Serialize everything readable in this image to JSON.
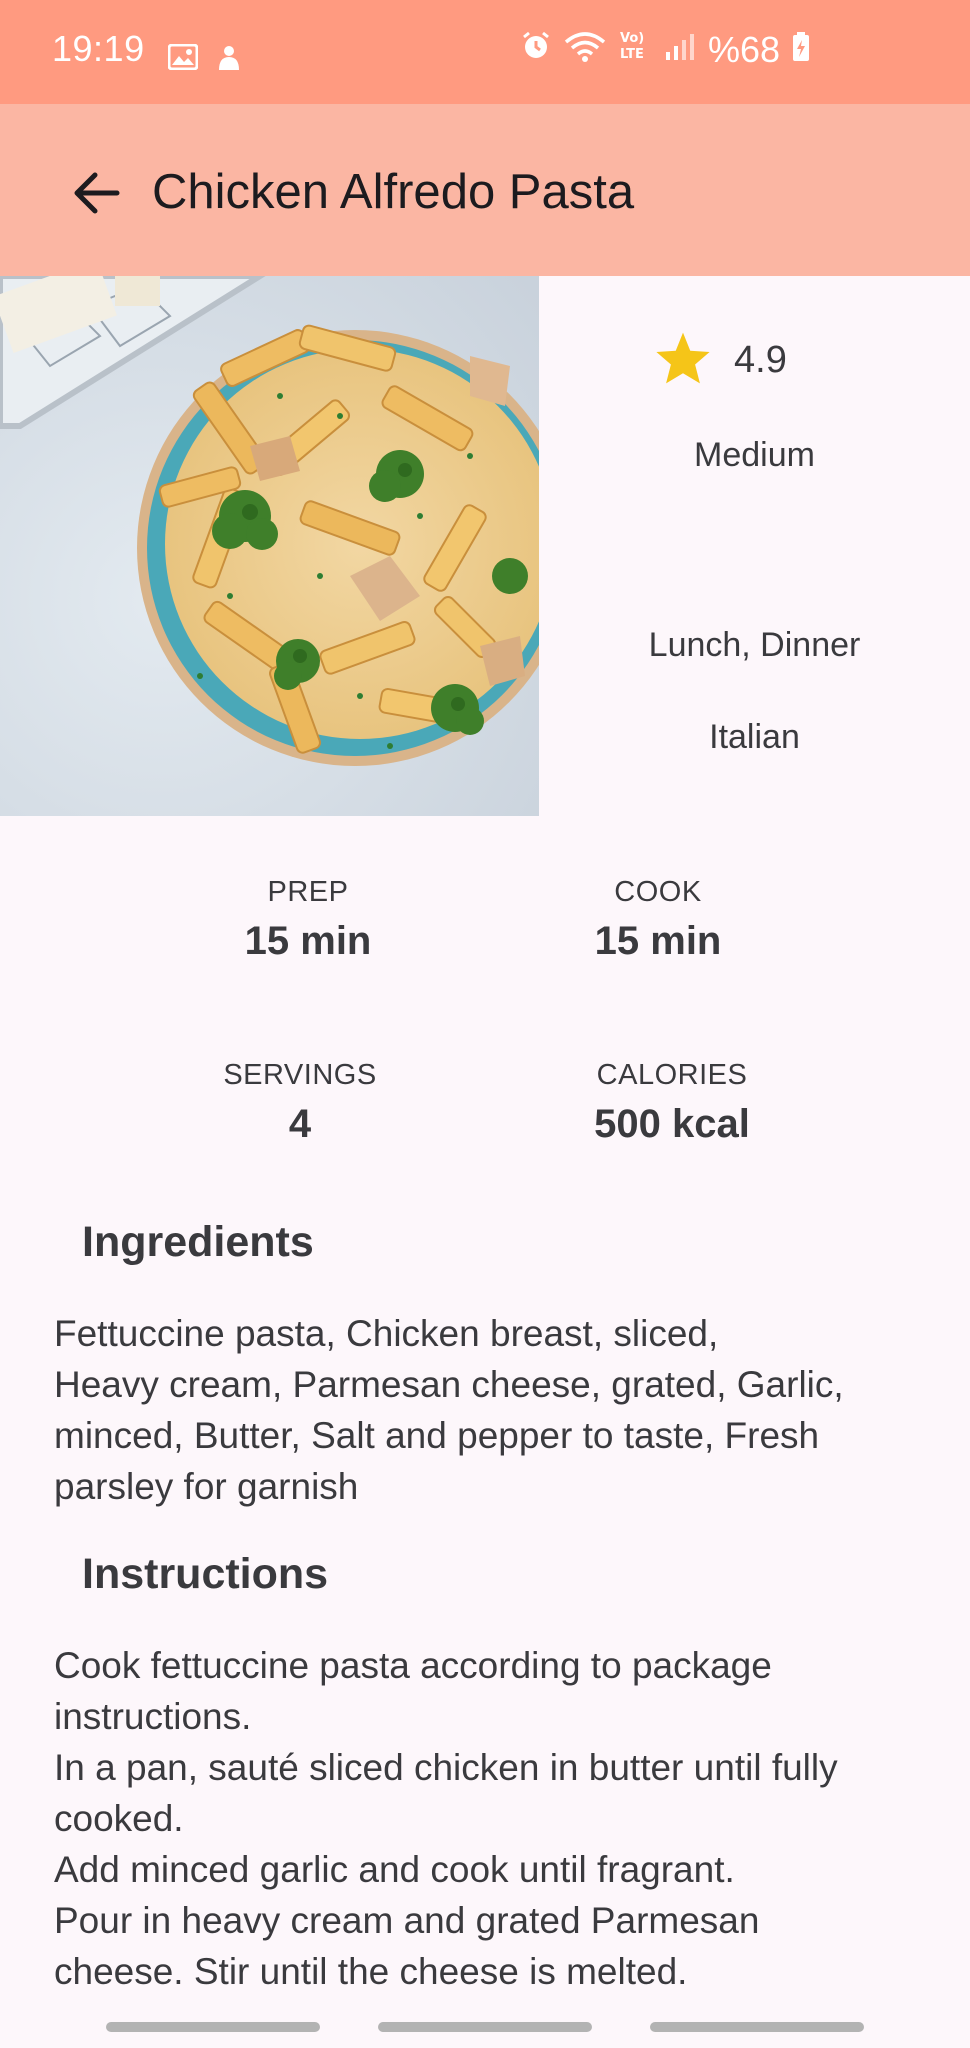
{
  "status_bar": {
    "time": "19:19",
    "battery": "%68",
    "network": "LTE",
    "icons": [
      "gallery-icon",
      "notification-icon",
      "alarm-icon",
      "wifi-icon",
      "volte-icon",
      "signal-icon",
      "battery-icon"
    ]
  },
  "app_bar": {
    "title": "Chicken Alfredo Pasta",
    "back_icon": "arrow-back-icon"
  },
  "recipe": {
    "image": "chicken-alfredo-pasta-photo",
    "rating": "4.9",
    "difficulty": "Medium",
    "meal_types": "Lunch, Dinner",
    "cuisine": "Italian"
  },
  "stats": {
    "prep_label": "PREP",
    "prep_value": "15  min",
    "cook_label": "COOK",
    "cook_value": "15 min",
    "servings_label": "SERVINGS",
    "servings_value": "4",
    "calories_label": "CALORIES",
    "calories_value": "500 kcal"
  },
  "ingredients": {
    "title": "Ingredients",
    "text": "Fettuccine pasta, Chicken breast, sliced,\nHeavy cream, Parmesan cheese, grated, Garlic,\nminced, Butter, Salt and pepper to taste, Fresh\nparsley for garnish"
  },
  "instructions": {
    "title": "Instructions",
    "text": "Cook fettuccine pasta according to package\ninstructions.\nIn a pan, sauté sliced chicken in butter until fully\ncooked.\nAdd minced garlic and cook until fragrant.\nPour in heavy cream and grated Parmesan\ncheese. Stir until the cheese is melted."
  },
  "colors": {
    "status_bar": "#ff9a80",
    "app_bar": "#fbb6a3",
    "background": "#fdf7fb",
    "star": "#f5c518",
    "text": "#3a3a3e"
  }
}
